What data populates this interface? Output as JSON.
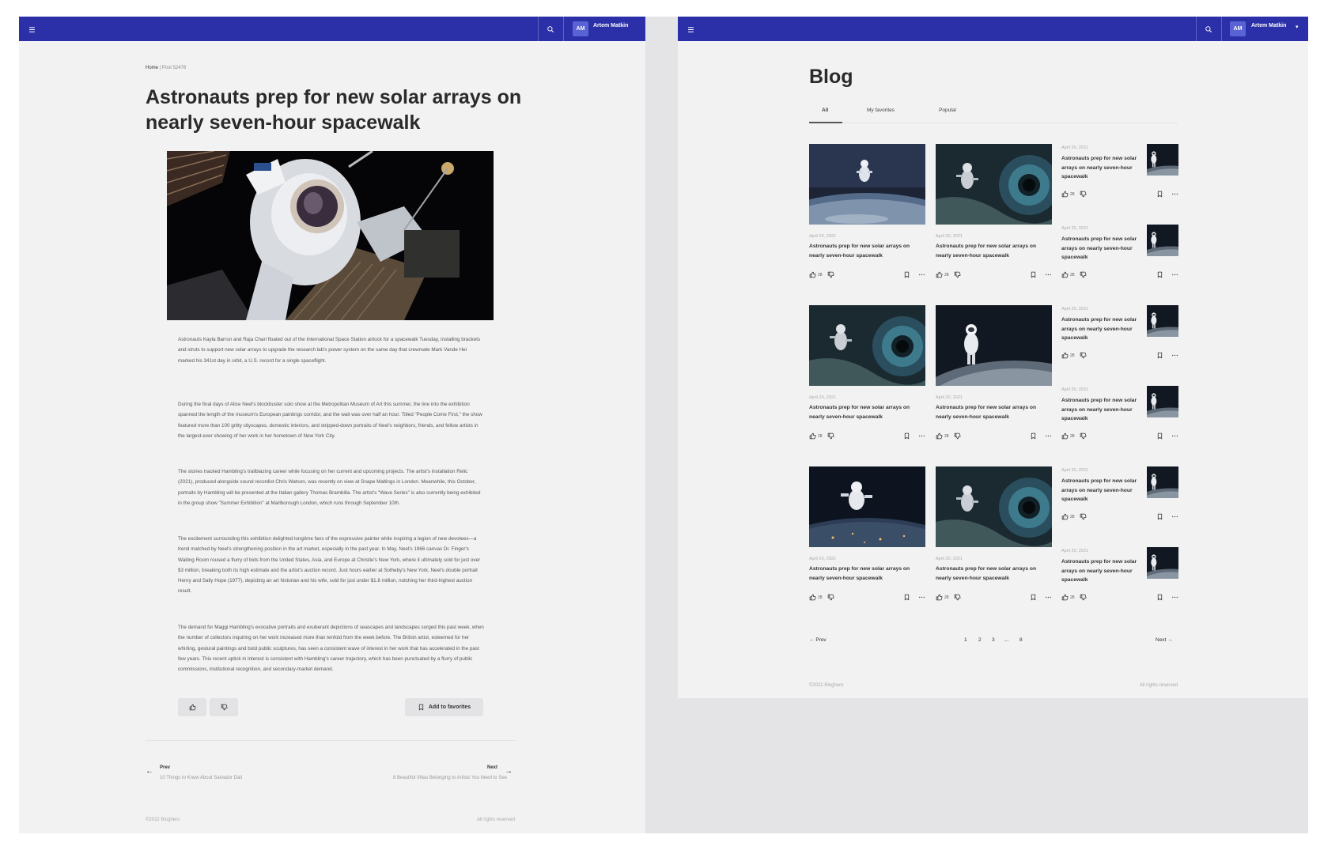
{
  "article_page": {
    "user": {
      "initials": "AM",
      "name": "Artem Matkin"
    },
    "breadcrumb": {
      "home": "Home",
      "separator": "|",
      "current": "Post 52476"
    },
    "title": "Astronauts prep for new solar arrays on nearly seven-hour spacewalk",
    "paragraphs": [
      "Astronauts Kayla Barron and Raja Chari floated out of the International Space Station airlock for a spacewalk Tuesday, installing brackets and struts to support new solar arrays to upgrade the research lab's power system on the same day that crewmate Mark Vande Hei marked his 341st day in orbit, a U.S. record for a single spaceflight.",
      "During the final days of Alice Neel's blockbuster solo show at the Metropolitan Museum of Art this summer, the line into the exhibition spanned the length of the museum's European paintings corridor, and the wait was over half an hour. Titled \"People Come First,\" the show featured more than 100 gritty cityscapes, domestic interiors, and stripped-down portraits of Neel's neighbors, friends, and fellow artists in the largest-ever showing of her work in her hometown of New York City.",
      "The stories tracked Hambling's trailblazing career while focusing on her current and upcoming projects. The artist's installation Relic (2021), produced alongside sound recordist Chris Watson, was recently on view at Snape Maltings in London. Meanwhile, this October, portraits by Hambling will be presented at the Italian gallery Thomas Brambilla. The artist's \"Wave Series\" is also currently being exhibited in the group show \"Summer Exhibition\" at Marlborough London, which runs through September 10th.",
      "The excitement surrounding this exhibition delighted longtime fans of the expressive painter while inspiring a legion of new devotees—a trend matched by Neel's strengthening position in the art market, especially in the past year. In May, Neel's 1966 canvas Dr. Finger's Waiting Room roused a flurry of bids from the United States, Asia, and Europe at Christie's New York, where it ultimately sold for just over $3 million, breaking both its high estimate and the artist's auction record. Just hours earlier at Sotheby's New York, Neel's double portrait Henry and Sally Hope (1977), depicting an art historian and his wife, sold for just under $1.8 million, notching her third-highest auction result.",
      "The demand for Maggi Hambling's evocative portraits and exuberant depictions of seascapes and landscapes surged this past week, when the number of collectors inquiring on her work increased more than tenfold from the week before. The British artist, esteemed for her whirling, gestural paintings and bold public sculptures, has seen a consistent wave of interest in her work that has accelerated in the past few years. This recent uptick in interest is consistent with Hambling's career trajectory, which has been punctuated by a flurry of public commissions, institutional recognition, and secondary-market demand."
    ],
    "add_to_favorites": "Add to favorites",
    "prev": {
      "label": "Prev",
      "title": "10 Things to Know About Salvador Dalí"
    },
    "next": {
      "label": "Next",
      "title": "8 Beautiful Villas Belonging to Artists You Need to See"
    },
    "footer": {
      "copyright": "©2022 Bloghero",
      "rights": "All rights reserved"
    }
  },
  "blog_page": {
    "user": {
      "initials": "AM",
      "name": "Artem Matkin"
    },
    "title": "Blog",
    "tabs": [
      "All",
      "My favorites",
      "Popular"
    ],
    "cards": [
      {
        "date": "April 20, 2021",
        "title": "Astronauts prep for new solar arrays on nearly seven-hour spacewalk",
        "likes": "28"
      },
      {
        "date": "April 20, 2021",
        "title": "Astronauts prep for new solar arrays on nearly seven-hour spacewalk",
        "likes": "28"
      },
      {
        "date": "April 20, 2021",
        "title": "Astronauts prep for new solar arrays on nearly seven-hour spacewalk",
        "likes": "28"
      },
      {
        "date": "April 20, 2021",
        "title": "Astronauts prep for new solar arrays on nearly seven-hour spacewalk",
        "likes": "28"
      },
      {
        "date": "April 20, 2021",
        "title": "Astronauts prep for new solar arrays on nearly seven-hour spacewalk",
        "likes": "28"
      },
      {
        "date": "April 20, 2021",
        "title": "Astronauts prep for new solar arrays on nearly seven-hour spacewalk",
        "likes": "28"
      }
    ],
    "side_items": [
      {
        "date": "April 20, 2021",
        "title": "Astronauts prep for new solar arrays on nearly seven-hour spacewalk",
        "likes": "28"
      },
      {
        "date": "April 20, 2021",
        "title": "Astronauts prep for new solar arrays on nearly seven-hour spacewalk",
        "likes": "28"
      },
      {
        "date": "April 20, 2021",
        "title": "Astronauts prep for new solar arrays on nearly seven-hour spacewalk",
        "likes": "28"
      },
      {
        "date": "April 20, 2021",
        "title": "Astronauts prep for new solar arrays on nearly seven-hour spacewalk",
        "likes": "28"
      },
      {
        "date": "April 20, 2021",
        "title": "Astronauts prep for new solar arrays on nearly seven-hour spacewalk",
        "likes": "28"
      },
      {
        "date": "April 20, 2021",
        "title": "Astronauts prep for new solar arrays on nearly seven-hour spacewalk",
        "likes": "28"
      }
    ],
    "pagination": {
      "prev": "Prev",
      "next": "Next",
      "pages": [
        "1",
        "2",
        "3",
        "...",
        "8"
      ]
    },
    "footer": {
      "copyright": "©2022 Bloghero",
      "rights": "All rights reserved"
    }
  },
  "colors": {
    "topbar": "#2b2fa8",
    "avatar": "#5a63d4",
    "page_bg": "#f2f2f3"
  },
  "icons": [
    "menu-icon",
    "search-icon",
    "chevron-down-icon",
    "thumb-up-icon",
    "thumb-down-icon",
    "bookmark-icon",
    "more-icon",
    "arrow-left-icon",
    "arrow-right-icon"
  ]
}
